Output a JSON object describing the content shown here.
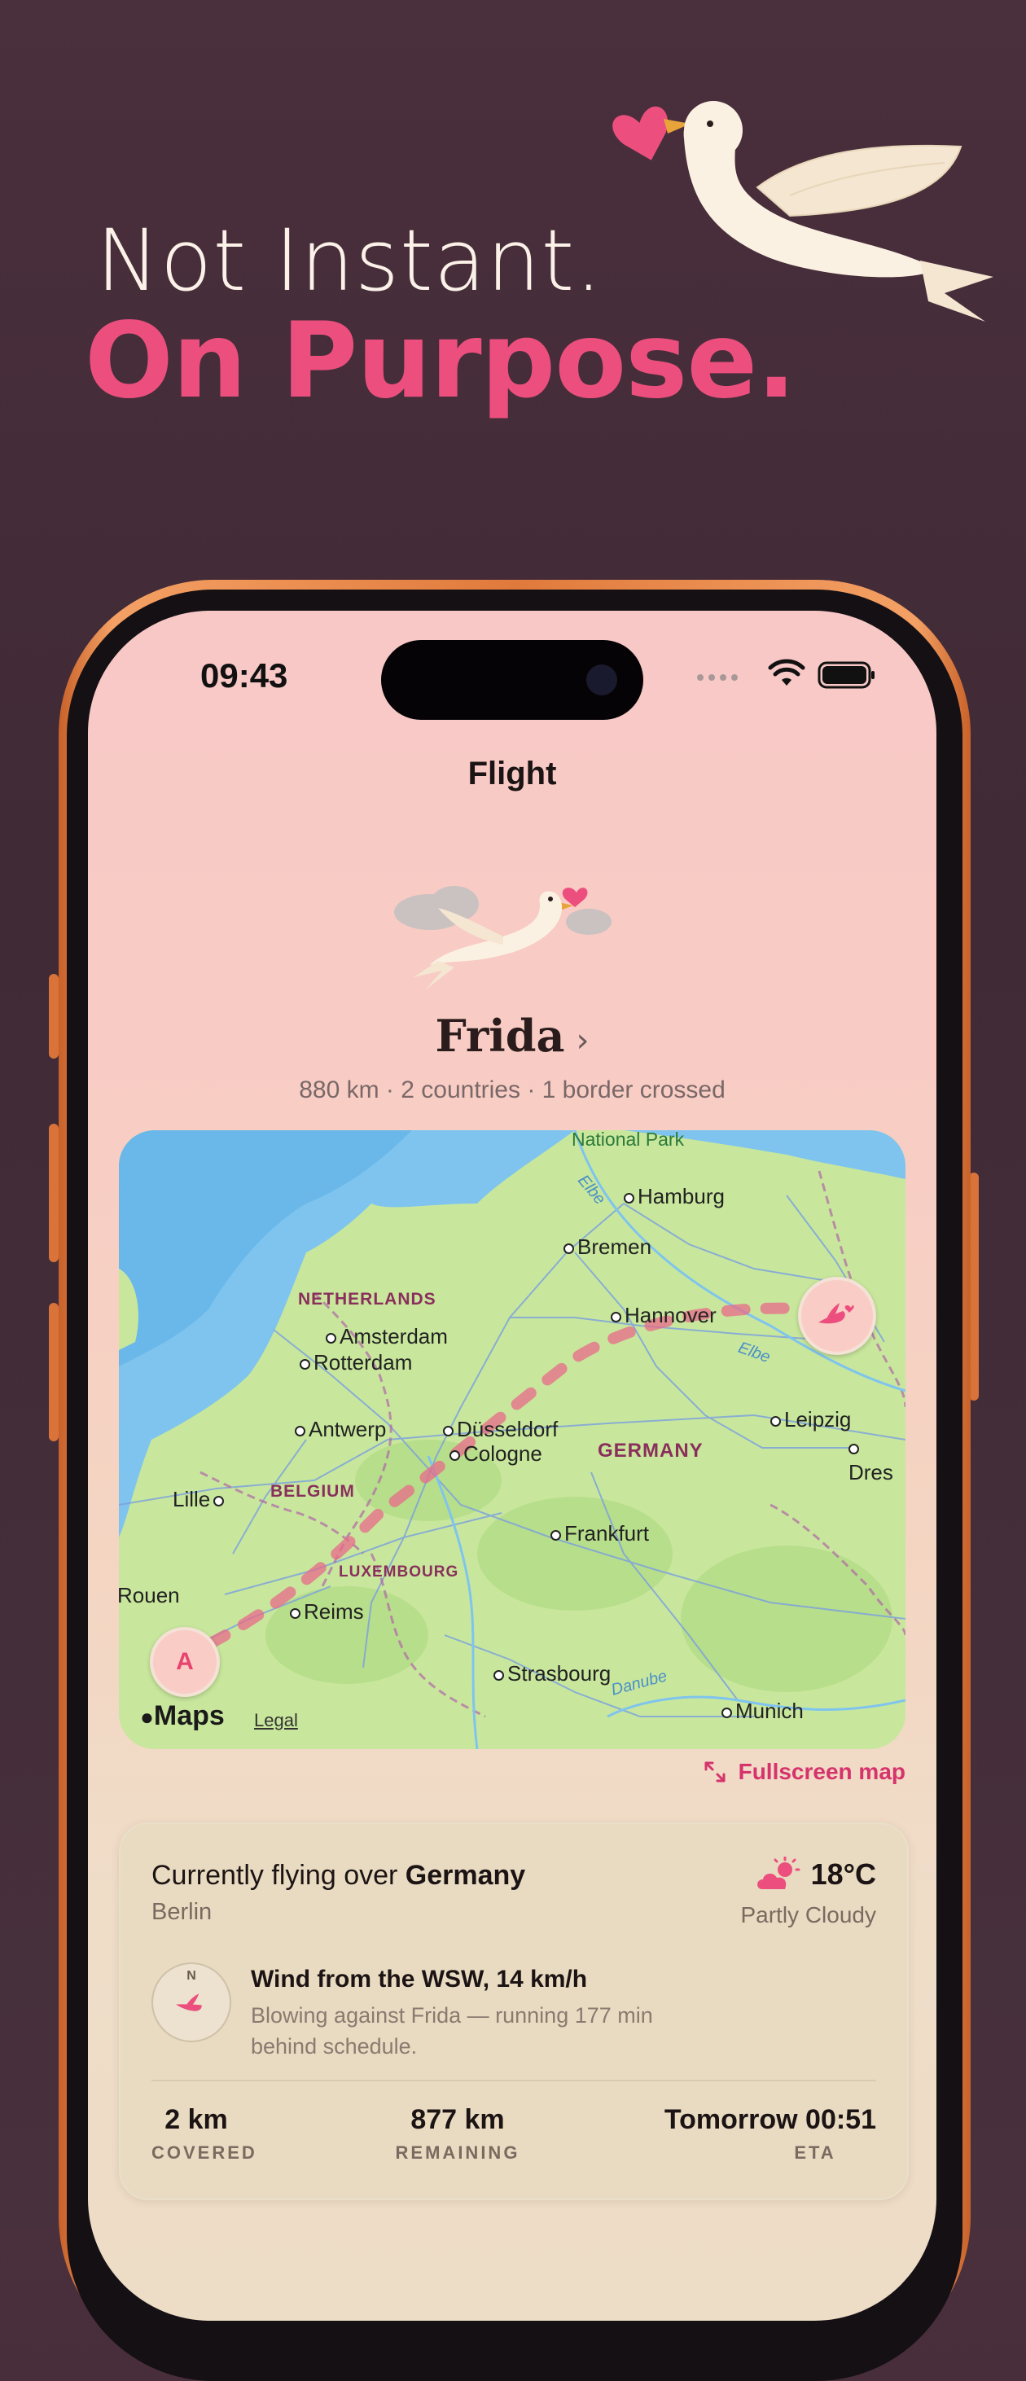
{
  "hero": {
    "line1": "Not Instant.",
    "line2": "On Purpose."
  },
  "status_bar": {
    "time": "09:43"
  },
  "nav": {
    "title": "Flight"
  },
  "bird": {
    "name": "Frida",
    "chevron": "›",
    "stats": "880 km · 2 countries · 1 border crossed"
  },
  "map": {
    "national_park": "National Park",
    "cities": [
      "Hamburg",
      "Bremen",
      "Hannover",
      "Amsterdam",
      "Rotterdam",
      "Antwerp",
      "Düsseldorf",
      "Cologne",
      "Leipzig",
      "Dres",
      "Lille",
      "Frankfurt",
      "Rouen",
      "Reims",
      "Strasbourg",
      "Munich"
    ],
    "countries": [
      "NETHERLANDS",
      "GERMANY",
      "BELGIUM",
      "LUXEMBOURG"
    ],
    "rivers": [
      "Elbe",
      "Elbe",
      "Danube"
    ],
    "start_badge": "A",
    "attribution": "Maps",
    "legal": "Legal"
  },
  "fullscreen_link": "Fullscreen map",
  "current": {
    "prefix": "Currently flying over ",
    "country": "Germany",
    "city": "Berlin",
    "temperature": "18°C",
    "condition": "Partly Cloudy",
    "weather_icon": "partly-cloudy-icon"
  },
  "wind": {
    "compass_label": "N",
    "title": "Wind from the WSW, 14 km/h",
    "description": "Blowing against Frida — running 177 min behind schedule."
  },
  "trip_stats": [
    {
      "value": "2 km",
      "label": "COVERED"
    },
    {
      "value": "877 km",
      "label": "REMAINING"
    },
    {
      "value": "Tomorrow 00:51",
      "label": "ETA"
    }
  ],
  "colors": {
    "accent": "#ec4f7e",
    "background": "#47303c",
    "phone_frame": "#e07a3c",
    "card": "#e9dbc1"
  }
}
